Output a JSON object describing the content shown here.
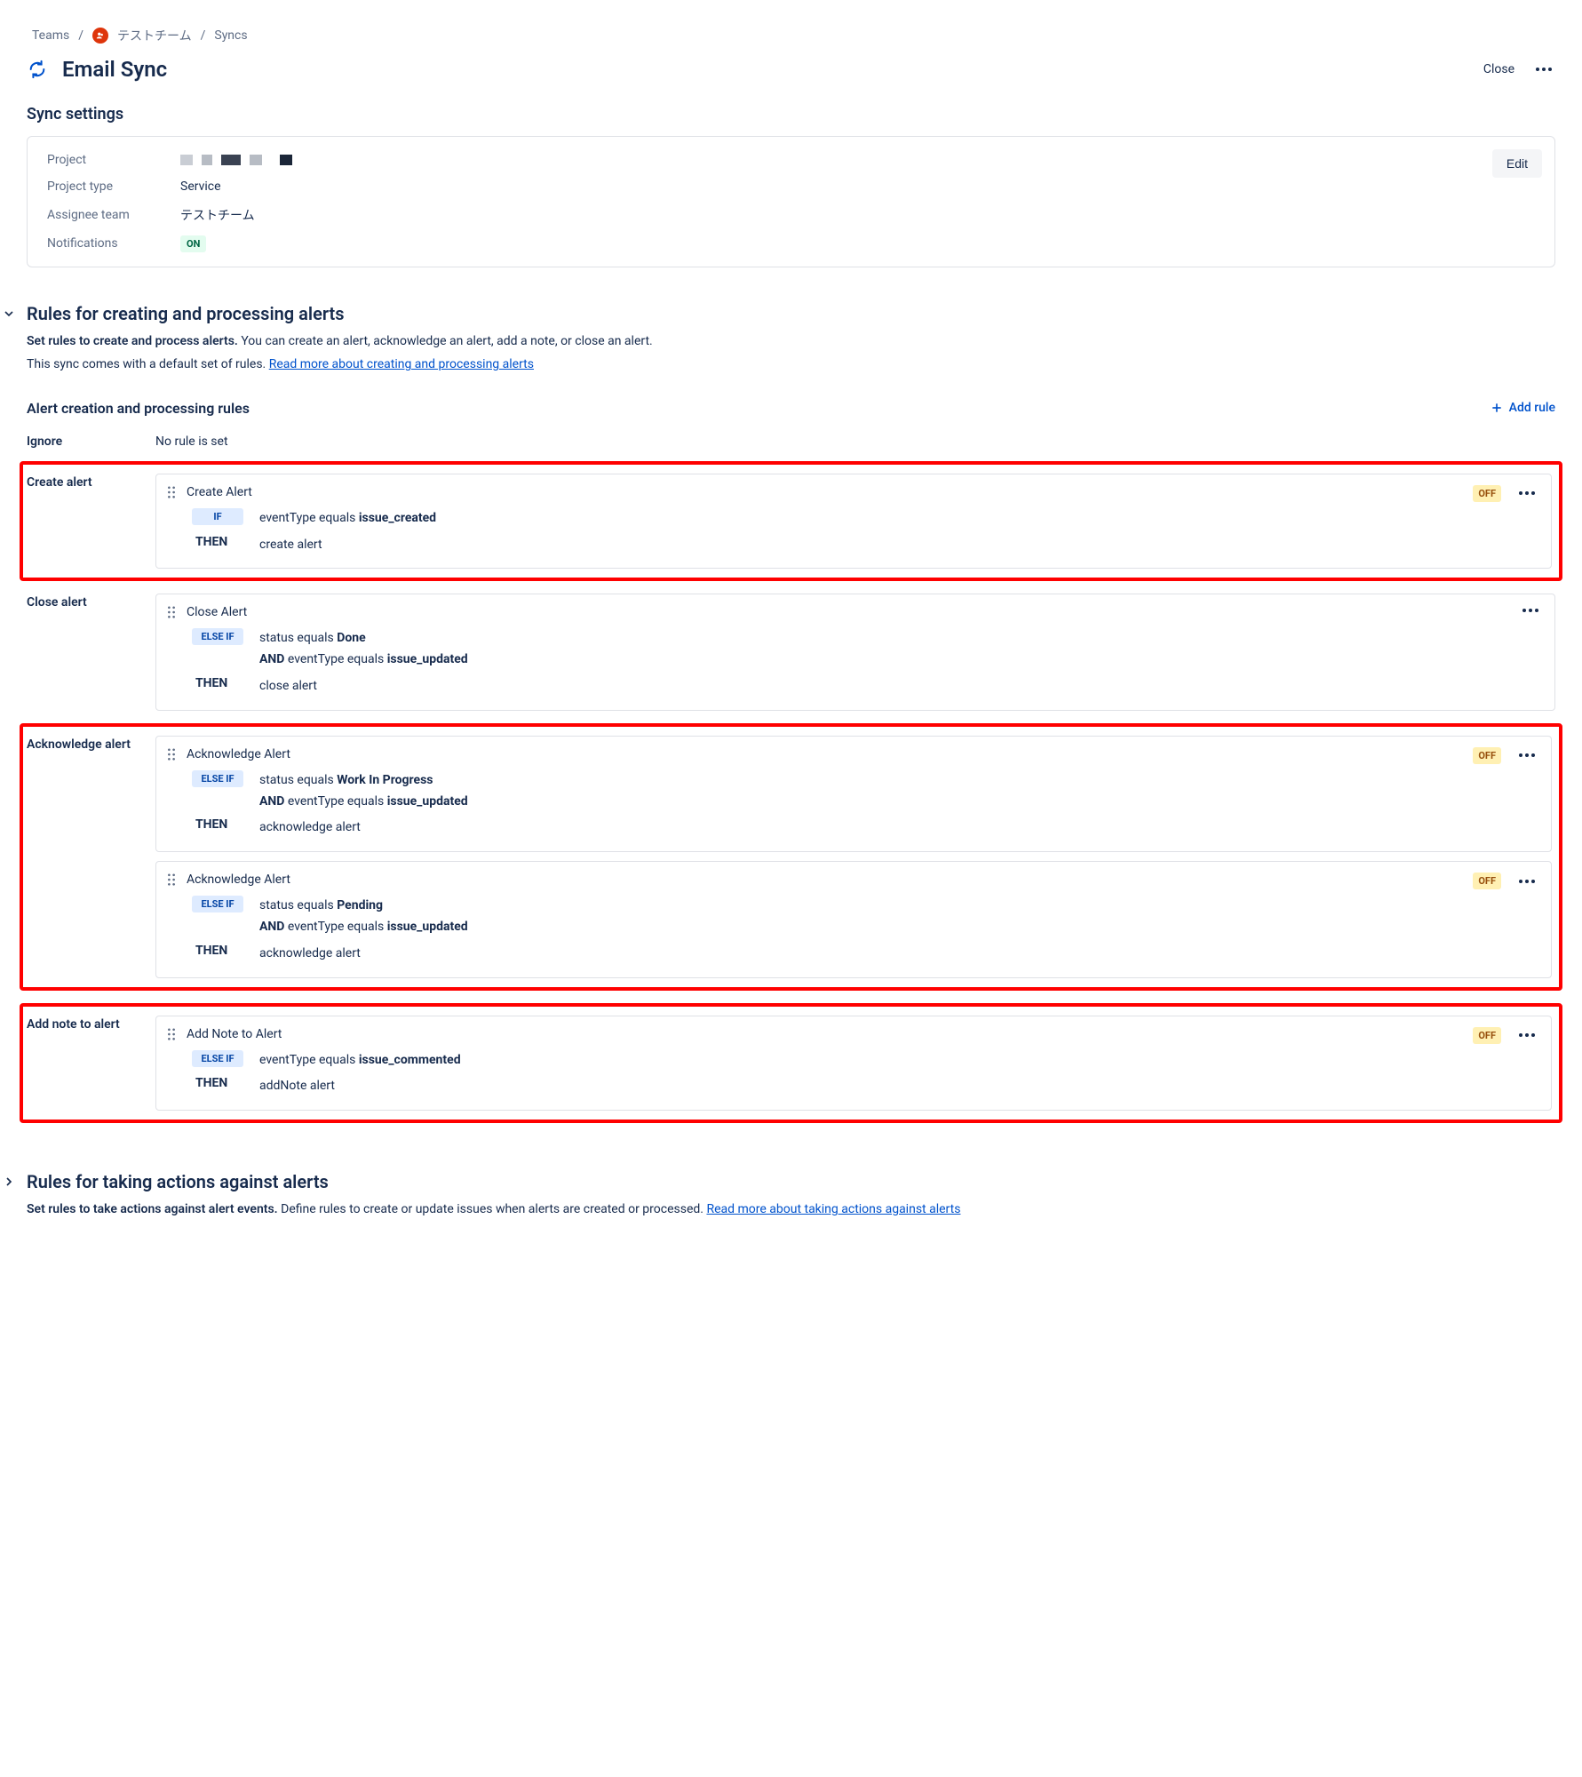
{
  "breadcrumb": {
    "teams": "Teams",
    "team_name": "テストチーム",
    "syncs": "Syncs"
  },
  "header": {
    "title": "Email Sync",
    "close": "Close"
  },
  "settings": {
    "heading": "Sync settings",
    "edit": "Edit",
    "project_label": "Project",
    "project_type_label": "Project type",
    "project_type_value": "Service",
    "assignee_label": "Assignee team",
    "assignee_value": "テストチーム",
    "notifications_label": "Notifications",
    "notifications_value": "ON"
  },
  "rules_section": {
    "heading": "Rules for creating and processing alerts",
    "desc_bold": "Set rules to create and process alerts.",
    "desc_rest": " You can create an alert, acknowledge an alert, add a note, or close an alert.",
    "desc_line2": "This sync comes with a default set of rules. ",
    "desc_link": "Read more about creating and processing alerts",
    "sub_heading": "Alert creation and processing rules",
    "add_rule": "Add rule",
    "ignore_label": "Ignore",
    "ignore_value": "No rule is set",
    "create_label": "Create alert",
    "close_label": "Close alert",
    "ack_label": "Acknowledge alert",
    "note_label": "Add note to alert"
  },
  "rule_create": {
    "name": "Create Alert",
    "status": "OFF",
    "if_tag": "IF",
    "if_text_pre": "eventType equals ",
    "if_text_bold": "issue_created",
    "then_tag": "THEN",
    "then_text": "create alert"
  },
  "rule_close": {
    "name": "Close Alert",
    "elseif_tag": "ELSE IF",
    "line1_pre": "status equals ",
    "line1_bold": "Done",
    "and_tag": "AND",
    "line2_pre": " eventType equals ",
    "line2_bold": "issue_updated",
    "then_tag": "THEN",
    "then_text": "close alert"
  },
  "rule_ack1": {
    "name": "Acknowledge Alert",
    "status": "OFF",
    "elseif_tag": "ELSE IF",
    "line1_pre": "status equals ",
    "line1_bold": "Work In Progress",
    "and_tag": "AND",
    "line2_pre": " eventType equals ",
    "line2_bold": "issue_updated",
    "then_tag": "THEN",
    "then_text": "acknowledge alert"
  },
  "rule_ack2": {
    "name": "Acknowledge Alert",
    "status": "OFF",
    "elseif_tag": "ELSE IF",
    "line1_pre": "status equals ",
    "line1_bold": "Pending",
    "and_tag": "AND",
    "line2_pre": " eventType equals ",
    "line2_bold": "issue_updated",
    "then_tag": "THEN",
    "then_text": "acknowledge alert"
  },
  "rule_note": {
    "name": "Add Note to Alert",
    "status": "OFF",
    "elseif_tag": "ELSE IF",
    "line1_pre": "eventType equals ",
    "line1_bold": "issue_commented",
    "then_tag": "THEN",
    "then_text": "addNote alert"
  },
  "actions_section": {
    "heading": "Rules for taking actions against alerts",
    "desc_bold": "Set rules to take actions against alert events.",
    "desc_rest": " Define rules to create or update issues when alerts are created or processed. ",
    "desc_link": "Read more about taking actions against alerts"
  }
}
